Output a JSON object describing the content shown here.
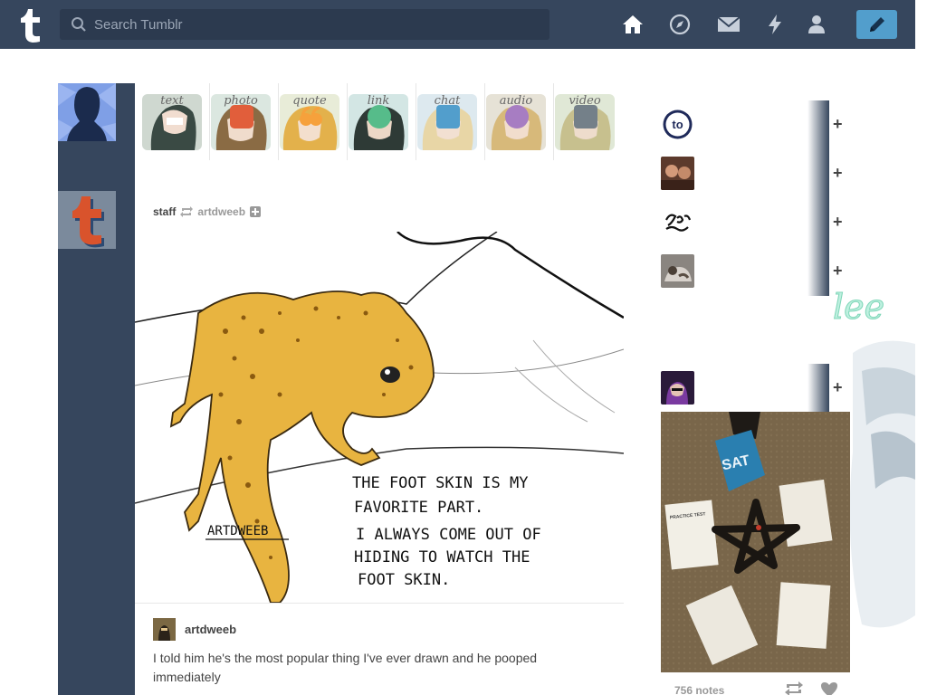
{
  "search": {
    "placeholder": "Search Tumblr"
  },
  "nav": {
    "icons": [
      "home-icon",
      "explore-icon",
      "mail-icon",
      "activity-icon",
      "account-icon",
      "compose-icon"
    ]
  },
  "post_types": [
    {
      "label": "text",
      "icon": "text-icon",
      "color": "#ffffff"
    },
    {
      "label": "photo",
      "icon": "camera-icon",
      "color": "#e15e3b"
    },
    {
      "label": "quote",
      "icon": "quote-icon",
      "color": "#f6a13c"
    },
    {
      "label": "link",
      "icon": "link-icon",
      "color": "#56bc8a"
    },
    {
      "label": "chat",
      "icon": "chat-icon",
      "color": "#529ecc"
    },
    {
      "label": "audio",
      "icon": "audio-icon",
      "color": "#a77dc2"
    },
    {
      "label": "video",
      "icon": "video-icon",
      "color": "#748089"
    }
  ],
  "post": {
    "author": "staff",
    "reblogged_from": "artdweeb",
    "artwork_text": {
      "signature": "ARTDWEEB",
      "line1": "THE FOOT SKIN IS MY",
      "line2": "FAVORITE PART.",
      "line3": "I ALWAYS COME OUT OF",
      "line4": "HIDING TO WATCH THE",
      "line5": "FOOT SKIN."
    },
    "caption_user": "artdweeb",
    "caption_text": "I told him he's the most popular thing I've ever drawn and he pooped immediately"
  },
  "sidebar": {
    "recommended": [
      {
        "avatar": "to-avatar",
        "action": "+"
      },
      {
        "avatar": "photo-avatar",
        "action": "+"
      },
      {
        "avatar": "good-avatar",
        "action": "+"
      },
      {
        "avatar": "cat-avatar",
        "action": "+"
      }
    ],
    "radar_blog": {
      "action": "+"
    },
    "radar_notes": "756 notes",
    "radar_text": {
      "badge": "to",
      "book": "SAT",
      "packet": "PRACTICE TEST",
      "watermark": "lee"
    }
  },
  "colors": {
    "navy": "#36465d",
    "accent": "#529ecc",
    "gecko": "#e8b440"
  }
}
